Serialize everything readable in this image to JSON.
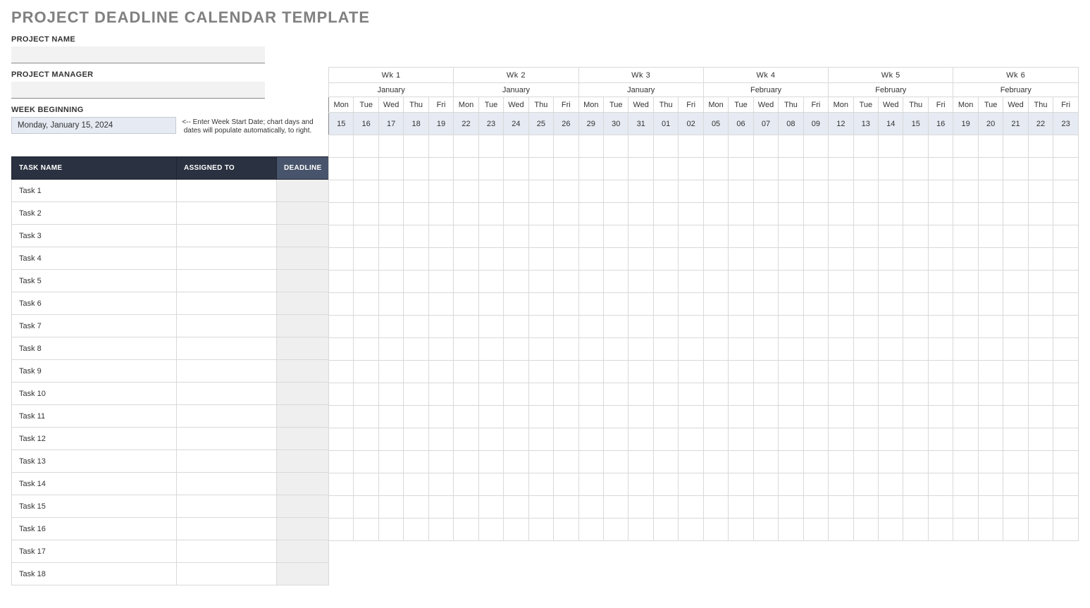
{
  "title": "PROJECT DEADLINE CALENDAR TEMPLATE",
  "fields": {
    "project_name_label": "PROJECT NAME",
    "project_name_value": "",
    "project_manager_label": "PROJECT MANAGER",
    "project_manager_value": "",
    "week_beginning_label": "WEEK BEGINNING",
    "week_beginning_value": "Monday, January 15, 2024",
    "week_beginning_hint": "<-- Enter Week Start Date; chart days and dates will populate automatically, to right."
  },
  "task_headers": {
    "task_name": "TASK NAME",
    "assigned_to": "ASSIGNED TO",
    "deadline": "DEADLINE"
  },
  "tasks": [
    {
      "name": "Task 1",
      "assigned": "",
      "deadline": ""
    },
    {
      "name": "Task 2",
      "assigned": "",
      "deadline": ""
    },
    {
      "name": "Task 3",
      "assigned": "",
      "deadline": ""
    },
    {
      "name": "Task 4",
      "assigned": "",
      "deadline": ""
    },
    {
      "name": "Task 5",
      "assigned": "",
      "deadline": ""
    },
    {
      "name": "Task 6",
      "assigned": "",
      "deadline": ""
    },
    {
      "name": "Task 7",
      "assigned": "",
      "deadline": ""
    },
    {
      "name": "Task 8",
      "assigned": "",
      "deadline": ""
    },
    {
      "name": "Task 9",
      "assigned": "",
      "deadline": ""
    },
    {
      "name": "Task 10",
      "assigned": "",
      "deadline": ""
    },
    {
      "name": "Task 11",
      "assigned": "",
      "deadline": ""
    },
    {
      "name": "Task 12",
      "assigned": "",
      "deadline": ""
    },
    {
      "name": "Task 13",
      "assigned": "",
      "deadline": ""
    },
    {
      "name": "Task 14",
      "assigned": "",
      "deadline": ""
    },
    {
      "name": "Task 15",
      "assigned": "",
      "deadline": ""
    },
    {
      "name": "Task 16",
      "assigned": "",
      "deadline": ""
    },
    {
      "name": "Task 17",
      "assigned": "",
      "deadline": ""
    },
    {
      "name": "Task 18",
      "assigned": "",
      "deadline": ""
    }
  ],
  "weeks": [
    {
      "label": "Wk 1",
      "month": "January",
      "days": [
        "Mon",
        "Tue",
        "Wed",
        "Thu",
        "Fri"
      ],
      "nums": [
        "15",
        "16",
        "17",
        "18",
        "19"
      ]
    },
    {
      "label": "Wk 2",
      "month": "January",
      "days": [
        "Mon",
        "Tue",
        "Wed",
        "Thu",
        "Fri"
      ],
      "nums": [
        "22",
        "23",
        "24",
        "25",
        "26"
      ]
    },
    {
      "label": "Wk 3",
      "month": "January",
      "days": [
        "Mon",
        "Tue",
        "Wed",
        "Thu",
        "Fri"
      ],
      "nums": [
        "29",
        "30",
        "31",
        "01",
        "02"
      ]
    },
    {
      "label": "Wk 4",
      "month": "February",
      "days": [
        "Mon",
        "Tue",
        "Wed",
        "Thu",
        "Fri"
      ],
      "nums": [
        "05",
        "06",
        "07",
        "08",
        "09"
      ]
    },
    {
      "label": "Wk 5",
      "month": "February",
      "days": [
        "Mon",
        "Tue",
        "Wed",
        "Thu",
        "Fri"
      ],
      "nums": [
        "12",
        "13",
        "14",
        "15",
        "16"
      ]
    },
    {
      "label": "Wk 6",
      "month": "February",
      "days": [
        "Mon",
        "Tue",
        "Wed",
        "Thu",
        "Fri"
      ],
      "nums": [
        "19",
        "20",
        "21",
        "22",
        "23"
      ]
    }
  ]
}
